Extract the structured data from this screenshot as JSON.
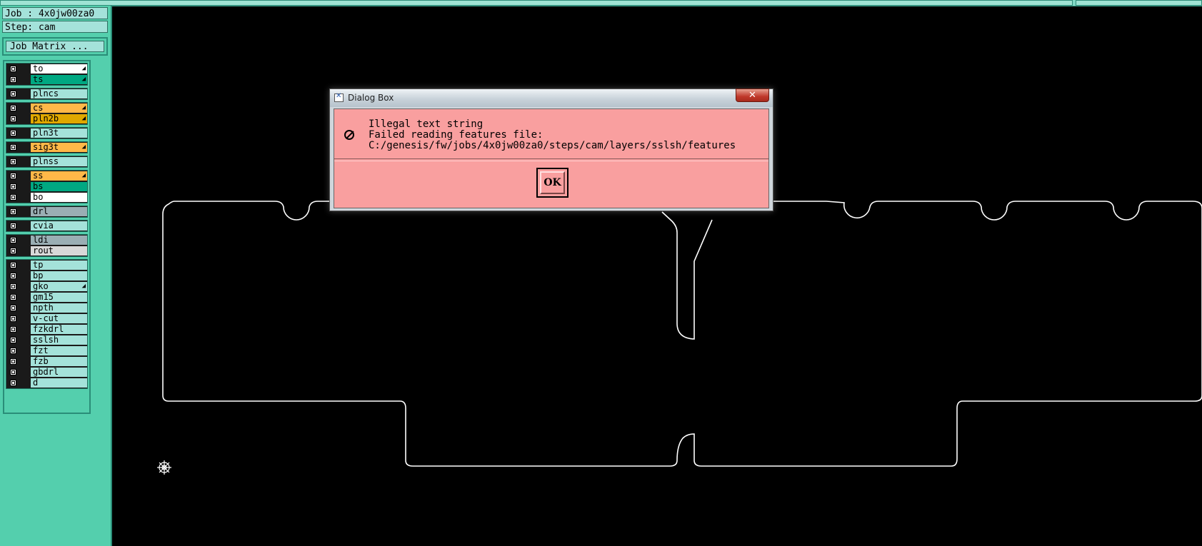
{
  "header": {
    "job": "Job : 4x0jw00za0",
    "step": "Step: cam"
  },
  "job_matrix_button": "Job Matrix ...",
  "layers": [
    {
      "name": "to",
      "color": "#ffffff",
      "marked": true
    },
    {
      "name": "ts",
      "color": "#00a882",
      "marked": true
    },
    {
      "name": "plncs",
      "color": "#a4e2da",
      "marked": false
    },
    {
      "name": "cs",
      "color": "#ffb848",
      "marked": true
    },
    {
      "name": "pln2b",
      "color": "#e0a800",
      "marked": true
    },
    {
      "name": "pln3t",
      "color": "#a4e2da",
      "marked": false
    },
    {
      "name": "sig3t",
      "color": "#ffb848",
      "marked": true
    },
    {
      "name": "plnss",
      "color": "#a4e2da",
      "marked": false
    },
    {
      "name": "ss",
      "color": "#ffb848",
      "marked": true
    },
    {
      "name": "bs",
      "color": "#00a882",
      "marked": false
    },
    {
      "name": "bo",
      "color": "#ffffff",
      "marked": false
    },
    {
      "name": "drl",
      "color": "#9aaeb4",
      "marked": false
    },
    {
      "name": "cvia",
      "color": "#a4e2da",
      "marked": false
    },
    {
      "name": "ldi",
      "color": "#9aaeb4",
      "marked": false
    },
    {
      "name": "rout",
      "color": "#d8d8d8",
      "marked": false
    },
    {
      "name": "tp",
      "color": "#a4e2da",
      "marked": false
    },
    {
      "name": "bp",
      "color": "#a4e2da",
      "marked": false
    },
    {
      "name": "gko",
      "color": "#a4e2da",
      "marked": true
    },
    {
      "name": "gm15",
      "color": "#a4e2da",
      "marked": false
    },
    {
      "name": "npth",
      "color": "#a4e2da",
      "marked": false
    },
    {
      "name": "v-cut",
      "color": "#a4e2da",
      "marked": false
    },
    {
      "name": "fzkdrl",
      "color": "#a4e2da",
      "marked": false
    },
    {
      "name": "sslsh",
      "color": "#a4e2da",
      "marked": false
    },
    {
      "name": "fzt",
      "color": "#a4e2da",
      "marked": false
    },
    {
      "name": "fzb",
      "color": "#a4e2da",
      "marked": false
    },
    {
      "name": "gbdrl",
      "color": "#a4e2da",
      "marked": false
    },
    {
      "name": "d",
      "color": "#a4e2da",
      "marked": false
    }
  ],
  "dialog": {
    "title": "Dialog Box",
    "close_glyph": "✕",
    "icon": "stop-icon",
    "lines": [
      "Illegal text string",
      "Failed reading features file:",
      "C:/genesis/fw/jobs/4x0jw00za0/steps/cam/layers/sslsh/features"
    ],
    "ok_label": "OK"
  },
  "colors": {
    "panel": "#54cfad",
    "dialog_body": "#f99f9f",
    "canvas": "#000000",
    "outline": "#ffffff"
  }
}
